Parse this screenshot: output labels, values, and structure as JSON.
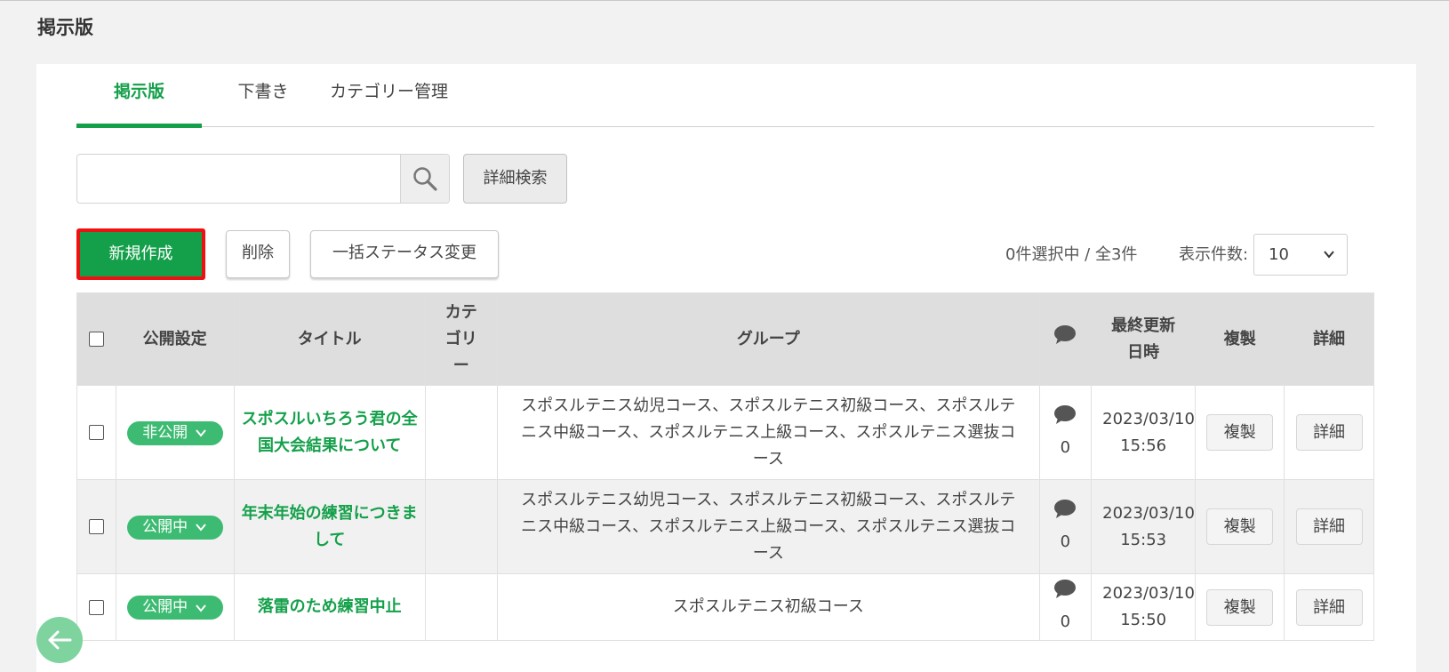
{
  "page": {
    "title": "掲示版"
  },
  "tabs": [
    {
      "label": "掲示版",
      "active": true
    },
    {
      "label": "下書き",
      "active": false
    },
    {
      "label": "カテゴリー管理",
      "active": false
    }
  ],
  "search": {
    "value": "",
    "placeholder": "",
    "advanced_label": "詳細検索"
  },
  "toolbar": {
    "new_label": "新規作成",
    "delete_label": "削除",
    "bulk_status_label": "一括ステータス変更",
    "selection_status": "0件選択中 / 全3件",
    "page_size_label": "表示件数:",
    "page_size_value": "10"
  },
  "table": {
    "headers": {
      "publish": "公開設定",
      "title": "タイトル",
      "category": "カテゴリー",
      "group": "グループ",
      "comments_icon": "speech-bubble-icon",
      "updated": "最終更新日時",
      "duplicate": "複製",
      "detail": "詳細"
    },
    "rows": [
      {
        "status": "非公開",
        "title": "スポスルいちろう君の全国大会結果について",
        "category": "",
        "groups": "スポスルテニス幼児コース、スポスルテニス初級コース、スポスルテニス中級コース、スポスルテニス上級コース、スポスルテニス選抜コース",
        "comments": "0",
        "updated": "2023/03/10 15:56",
        "duplicate": "複製",
        "detail": "詳細"
      },
      {
        "status": "公開中",
        "title": "年末年始の練習につきまして",
        "category": "",
        "groups": "スポスルテニス幼児コース、スポスルテニス初級コース、スポスルテニス中級コース、スポスルテニス上級コース、スポスルテニス選抜コース",
        "comments": "0",
        "updated": "2023/03/10 15:53",
        "duplicate": "複製",
        "detail": "詳細"
      },
      {
        "status": "公開中",
        "title": "落雷のため練習中止",
        "category": "",
        "groups": "スポスルテニス初級コース",
        "comments": "0",
        "updated": "2023/03/10 15:50",
        "duplicate": "複製",
        "detail": "詳細"
      }
    ]
  },
  "colors": {
    "accent": "#14a04a",
    "pill": "#3dbb72",
    "highlight_border": "#ee1111"
  }
}
